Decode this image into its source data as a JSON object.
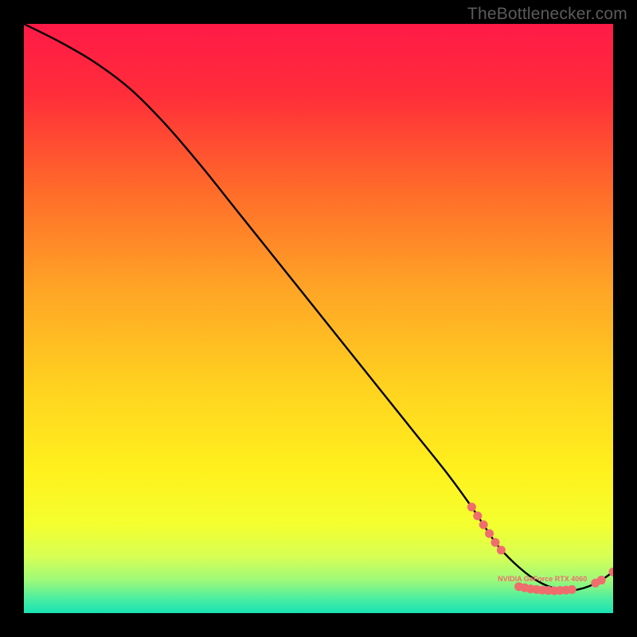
{
  "watermark": "TheBottlenecker.com",
  "gradient": {
    "stops": [
      {
        "offset": 0.0,
        "color": "#ff1a47"
      },
      {
        "offset": 0.12,
        "color": "#ff2d3a"
      },
      {
        "offset": 0.28,
        "color": "#ff6a2a"
      },
      {
        "offset": 0.45,
        "color": "#ffa526"
      },
      {
        "offset": 0.62,
        "color": "#ffd31f"
      },
      {
        "offset": 0.76,
        "color": "#fff11e"
      },
      {
        "offset": 0.85,
        "color": "#f4ff2f"
      },
      {
        "offset": 0.905,
        "color": "#d6ff55"
      },
      {
        "offset": 0.945,
        "color": "#9cf97a"
      },
      {
        "offset": 0.975,
        "color": "#4ceea0"
      },
      {
        "offset": 1.0,
        "color": "#18e3b4"
      }
    ]
  },
  "chart_data": {
    "type": "line",
    "title": "",
    "xlabel": "",
    "ylabel": "",
    "xlim": [
      0,
      100
    ],
    "ylim": [
      0,
      100
    ],
    "grid": false,
    "legend": false,
    "series": [
      {
        "name": "curve",
        "x": [
          0,
          6,
          12,
          18,
          24,
          30,
          36,
          42,
          48,
          54,
          60,
          66,
          72,
          76,
          80,
          82,
          84,
          86,
          88,
          90,
          92,
          94,
          96,
          98,
          100
        ],
        "y": [
          100,
          97,
          93.5,
          89,
          83,
          76,
          68.5,
          61,
          53.5,
          46,
          38.5,
          31,
          23.5,
          18,
          12,
          9.7,
          7.8,
          6.2,
          5.0,
          4.2,
          3.8,
          4.0,
          4.6,
          5.6,
          7.0
        ]
      }
    ],
    "markers": {
      "name": "highlight-dots",
      "color": "#ef6d6d",
      "points": [
        {
          "x": 76,
          "y": 18
        },
        {
          "x": 77,
          "y": 16.5
        },
        {
          "x": 78,
          "y": 15
        },
        {
          "x": 79,
          "y": 13.5
        },
        {
          "x": 80,
          "y": 12
        },
        {
          "x": 81,
          "y": 10.7
        },
        {
          "x": 84,
          "y": 4.5
        },
        {
          "x": 85,
          "y": 4.3
        },
        {
          "x": 86,
          "y": 4.1
        },
        {
          "x": 87,
          "y": 4.0
        },
        {
          "x": 88,
          "y": 3.9
        },
        {
          "x": 89,
          "y": 3.85
        },
        {
          "x": 90,
          "y": 3.8
        },
        {
          "x": 91,
          "y": 3.85
        },
        {
          "x": 92,
          "y": 3.9
        },
        {
          "x": 93,
          "y": 4.0
        },
        {
          "x": 97,
          "y": 5.1
        },
        {
          "x": 98,
          "y": 5.6
        },
        {
          "x": 100,
          "y": 7.0
        }
      ]
    },
    "annotation": {
      "text": "NVIDIA GeForce RTX 4060",
      "x": 88,
      "y": 5.4,
      "color": "#ef6d6d"
    }
  }
}
